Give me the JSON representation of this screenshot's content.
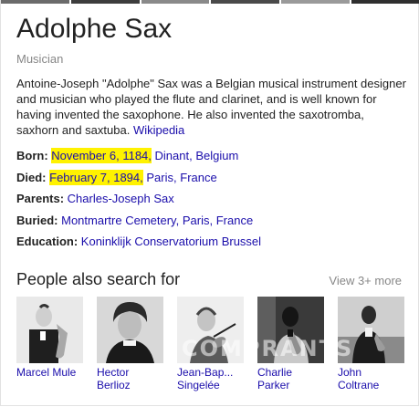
{
  "entity": {
    "name": "Adolphe Sax",
    "type": "Musician"
  },
  "description": {
    "text": "Antoine-Joseph \"Adolphe\" Sax was a Belgian musical instrument designer and musician who played the flute and clarinet, and is well known for having invented the saxophone. He also invented the saxotromba, saxhorn and saxtuba.",
    "source_link": "Wikipedia"
  },
  "facts": {
    "born": {
      "label": "Born:",
      "date": "November 6, 1184,",
      "place1": "Dinant",
      "sep": ",",
      "place2": "Belgium"
    },
    "died": {
      "label": "Died:",
      "date": "February 7, 1894,",
      "place1": "Paris",
      "sep": ",",
      "place2": "France"
    },
    "parents": {
      "label": "Parents:",
      "value": "Charles-Joseph Sax"
    },
    "buried": {
      "label": "Buried:",
      "place1": "Montmartre Cemetery",
      "sep1": ",",
      "place2": "Paris",
      "sep2": ",",
      "place3": "France"
    },
    "education": {
      "label": "Education:",
      "value": "Koninklijk Conservatorium Brussel"
    }
  },
  "people_also_search": {
    "title": "People also search for",
    "view_more": "View 3+ more",
    "people": [
      {
        "first": "Marcel Mule",
        "second": "",
        "icon": "saxophonist-portrait"
      },
      {
        "first": "Hector",
        "second": "Berlioz",
        "icon": "man-portrait"
      },
      {
        "first": "Jean-Bap...",
        "second": "Singelée",
        "icon": "violinist-portrait"
      },
      {
        "first": "Charlie",
        "second": "Parker",
        "icon": "saxophonist-portrait"
      },
      {
        "first": "John",
        "second": "Coltrane",
        "icon": "saxophonist-portrait"
      }
    ]
  },
  "watermark": "COMPRANTS",
  "colors": {
    "link": "#1a0dab",
    "highlight": "#fff200",
    "muted": "#878787",
    "text": "#222222"
  }
}
